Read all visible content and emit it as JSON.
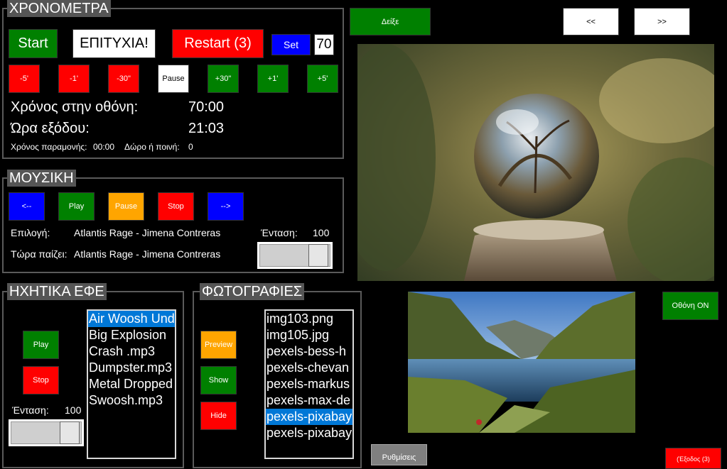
{
  "timers": {
    "title": "ΧΡΟΝΟΜΕΤΡΑ",
    "start": "Start",
    "status": "ΕΠΙΤΥΧΙΑ!",
    "restart": "Restart (3)",
    "set": "Set",
    "set_value": "70",
    "minus5": "-5'",
    "minus1": "-1'",
    "minus30": "-30\"",
    "pause": "Pause",
    "plus30": "+30\"",
    "plus1": "+1'",
    "plus5": "+5'",
    "screen_time_label": "Χρόνος στην οθόνη:",
    "screen_time_value": "70:00",
    "exit_time_label": "Ώρα εξόδου:",
    "exit_time_value": "21:03",
    "stay_time_label": "Χρόνος παραμονής:",
    "stay_time_value": "00:00",
    "gift_label": "Δώρο ή ποινή:",
    "gift_value": "0"
  },
  "music": {
    "title": "ΜΟΥΣΙΚΗ",
    "prev": "<--",
    "play": "Play",
    "pause": "Pause",
    "stop": "Stop",
    "next": "-->",
    "selection_label": "Επιλογή:",
    "selection_value": "Atlantis Rage - Jimena Contreras",
    "volume_label": "Ένταση:",
    "volume_value": "100",
    "now_playing_label": "Τώρα παίζει:",
    "now_playing_value": "Atlantis Rage - Jimena Contreras",
    "volume_level": 1.0
  },
  "sfx": {
    "title": "ΗΧΗΤΙΚΑ ΕΦΕ",
    "play": "Play",
    "stop": "Stop",
    "volume_label": "Ένταση:",
    "volume_value": "100",
    "volume_level": 1.0,
    "items": [
      "Air Woosh Und",
      "Big Explosion",
      "Crash .mp3",
      "Dumpster.mp3",
      "Metal Dropped",
      "Swoosh.mp3"
    ],
    "selected_index": 0
  },
  "photos": {
    "title": "ΦΩΤΟΓΡΑΦΙΕΣ",
    "preview": "Preview",
    "show": "Show",
    "hide": "Hide",
    "items": [
      "img103.png",
      "img105.jpg",
      "pexels-bess-h",
      "pexels-chevan",
      "pexels-markus",
      "pexels-max-de",
      "pexels-pixabay",
      "pexels-pixabay"
    ],
    "selected_index": 6
  },
  "top": {
    "show": "Δείξε",
    "prev": "<<",
    "next": ">>"
  },
  "screen_on": "Οθόνη ON",
  "settings": "Ρυθμίσεις",
  "exit_partial": "(Έξοδος (3)",
  "colors": {
    "red": "#ff0000",
    "green": "#008000",
    "blue": "#0000ff",
    "orange": "#ffa500",
    "selection": "#0078d7"
  }
}
